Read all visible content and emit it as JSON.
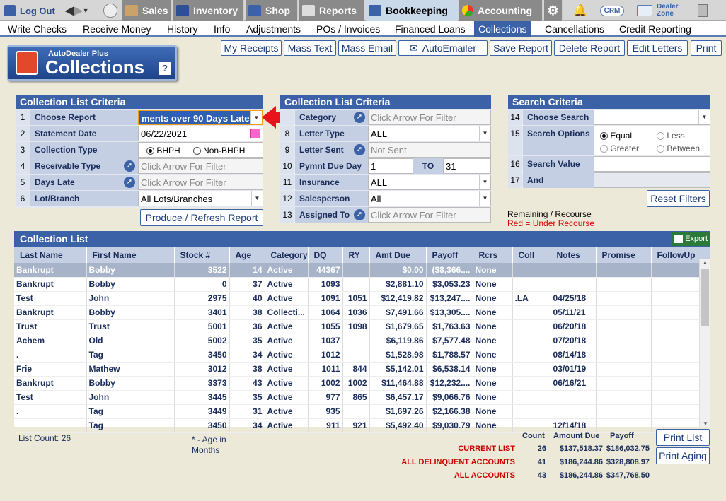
{
  "topbar": {
    "logout": "Log Out",
    "tabs": [
      {
        "label": "Sales",
        "icon": "sales-icon"
      },
      {
        "label": "Inventory",
        "icon": "car-icon"
      },
      {
        "label": "Shop",
        "icon": "wrench-icon"
      },
      {
        "label": "Reports",
        "icon": "report-icon"
      },
      {
        "label": "Bookkeeping",
        "icon": "book-icon"
      },
      {
        "label": "Accounting",
        "icon": "pie-icon"
      }
    ],
    "crm": "CRM",
    "dealer_zone_1": "Dealer",
    "dealer_zone_2": "Zone"
  },
  "submenu": [
    "Write Checks",
    "Receive Money",
    "History",
    "Info",
    "Adjustments",
    "POs / Invoices",
    "Financed Loans",
    "Collections",
    "Cancellations",
    "Credit Reporting"
  ],
  "toolbar": {
    "my_receipts": "My Receipts",
    "mass_text": "Mass Text",
    "mass_email": "Mass Email",
    "autoemailer": "AutoEmailer",
    "save_report": "Save Report",
    "delete_report": "Delete Report",
    "edit_letters": "Edit Letters",
    "print": "Print"
  },
  "logo": {
    "brand": "AutoDealer Plus",
    "title": "Collections",
    "help": "?"
  },
  "panel1": {
    "title": "Collection List Criteria",
    "rows": [
      {
        "n": "1",
        "label": "Choose Report",
        "value": "ments over 90 Days Late"
      },
      {
        "n": "2",
        "label": "Statement Date",
        "value": "06/22/2021"
      },
      {
        "n": "3",
        "label": "Collection Type",
        "opt1": "BHPH",
        "opt2": "Non-BHPH"
      },
      {
        "n": "4",
        "label": "Receivable Type",
        "value": "Click Arrow For Filter"
      },
      {
        "n": "5",
        "label": "Days Late",
        "value": "Click Arrow For Filter"
      },
      {
        "n": "6",
        "label": "Lot/Branch",
        "value": "All Lots/Branches"
      }
    ],
    "produce": "Produce / Refresh Report"
  },
  "panel2": {
    "title": "Collection List Criteria",
    "rows": [
      {
        "n": "",
        "label": "Category",
        "value": "Click Arrow For Filter"
      },
      {
        "n": "8",
        "label": "Letter Type",
        "value": "ALL"
      },
      {
        "n": "9",
        "label": "Letter Sent",
        "value": "Not Sent"
      },
      {
        "n": "10",
        "label": "Pymnt Due Day",
        "value": "1",
        "to": "TO",
        "value2": "31"
      },
      {
        "n": "11",
        "label": "Insurance",
        "value": "ALL"
      },
      {
        "n": "12",
        "label": "Salesperson",
        "value": "All"
      },
      {
        "n": "13",
        "label": "Assigned To",
        "value": "Click Arrow For Filter"
      }
    ]
  },
  "panel3": {
    "title": "Search Criteria",
    "rows": [
      {
        "n": "14",
        "label": "Choose Search"
      },
      {
        "n": "15",
        "label": "Search Options",
        "opts": [
          "Equal",
          "Less",
          "Greater",
          "Between"
        ]
      },
      {
        "n": "16",
        "label": "Search Value"
      },
      {
        "n": "17",
        "label": "And"
      }
    ],
    "reset": "Reset Filters"
  },
  "legend": {
    "line1": "Remaining / Recourse",
    "line2": "Red = Under Recourse"
  },
  "list": {
    "title": "Collection List",
    "export": "Export",
    "columns": [
      "Last Name",
      "First Name",
      "Stock #",
      "Age",
      "Category",
      "DQ",
      "RY",
      "Amt Due",
      "Payoff",
      "Rcrs",
      "Coll",
      "Notes",
      "Promise",
      "FollowUp"
    ],
    "rows": [
      [
        "Bankrupt",
        "Bobby",
        "3522",
        "14",
        "Active",
        "44367",
        "",
        "$0.00",
        "($8,366....",
        "None",
        "",
        "",
        "",
        ""
      ],
      [
        "Bankrupt",
        "Bobby",
        "0",
        "37",
        "Active",
        "1093",
        "",
        "$2,881.10",
        "$3,053.23",
        "None",
        "",
        "",
        "",
        ""
      ],
      [
        "Test",
        "John",
        "2975",
        "40",
        "Active",
        "1091",
        "1051",
        "$12,419.82",
        "$13,247....",
        "None",
        ".LA",
        "04/25/18",
        "",
        ""
      ],
      [
        "Bankrupt",
        "Bobby",
        "3401",
        "38",
        "Collecti...",
        "1064",
        "1036",
        "$7,491.66",
        "$13,305....",
        "None",
        "",
        "05/11/21",
        "",
        ""
      ],
      [
        "Trust",
        "Trust",
        "5001",
        "36",
        "Active",
        "1055",
        "1098",
        "$1,679.65",
        "$1,763.63",
        "None",
        "",
        "06/20/18",
        "",
        ""
      ],
      [
        "Achem",
        "Old",
        "5002",
        "35",
        "Active",
        "1037",
        "",
        "$6,119.86",
        "$7,577.48",
        "None",
        "",
        "07/20/18",
        "",
        ""
      ],
      [
        ".",
        "Tag",
        "3450",
        "34",
        "Active",
        "1012",
        "",
        "$1,528.98",
        "$1,788.57",
        "None",
        "",
        "08/14/18",
        "",
        ""
      ],
      [
        "Frie",
        "Mathew",
        "3012",
        "38",
        "Active",
        "1011",
        "844",
        "$5,142.01",
        "$6,538.14",
        "None",
        "",
        "03/01/19",
        "",
        ""
      ],
      [
        "Bankrupt",
        "Bobby",
        "3373",
        "43",
        "Active",
        "1002",
        "1002",
        "$11,464.88",
        "$12,232....",
        "None",
        "",
        "06/16/21",
        "",
        ""
      ],
      [
        "Test",
        "John",
        "3445",
        "35",
        "Active",
        "977",
        "865",
        "$6,457.17",
        "$9,066.76",
        "None",
        "",
        "",
        "",
        ""
      ],
      [
        ".",
        "Tag",
        "3449",
        "31",
        "Active",
        "935",
        "",
        "$1,697.26",
        "$2,166.38",
        "None",
        "",
        "",
        "",
        ""
      ],
      [
        "",
        "Tag",
        "3450",
        "34",
        "Active",
        "911",
        "921",
        "$5,492.40",
        "$9,030.79",
        "None",
        "",
        "12/14/18",
        "",
        ""
      ]
    ]
  },
  "footer": {
    "list_count_label": "List Count:",
    "list_count": "26",
    "age_note_1": "* - Age in",
    "age_note_2": "Months",
    "headers": [
      "Count",
      "Amount Due",
      "Payoff"
    ],
    "rows": [
      {
        "label": "CURRENT LIST",
        "count": "26",
        "amt": "$137,518.37",
        "payoff": "$186,032.75"
      },
      {
        "label": "ALL DELINQUENT ACCOUNTS",
        "count": "41",
        "amt": "$186,244.86",
        "payoff": "$328,808.97"
      },
      {
        "label": "ALL ACCOUNTS",
        "count": "43",
        "amt": "$186,244.86",
        "payoff": "$347,768.50"
      }
    ],
    "print_list": "Print List",
    "print_aging": "Print Aging"
  }
}
